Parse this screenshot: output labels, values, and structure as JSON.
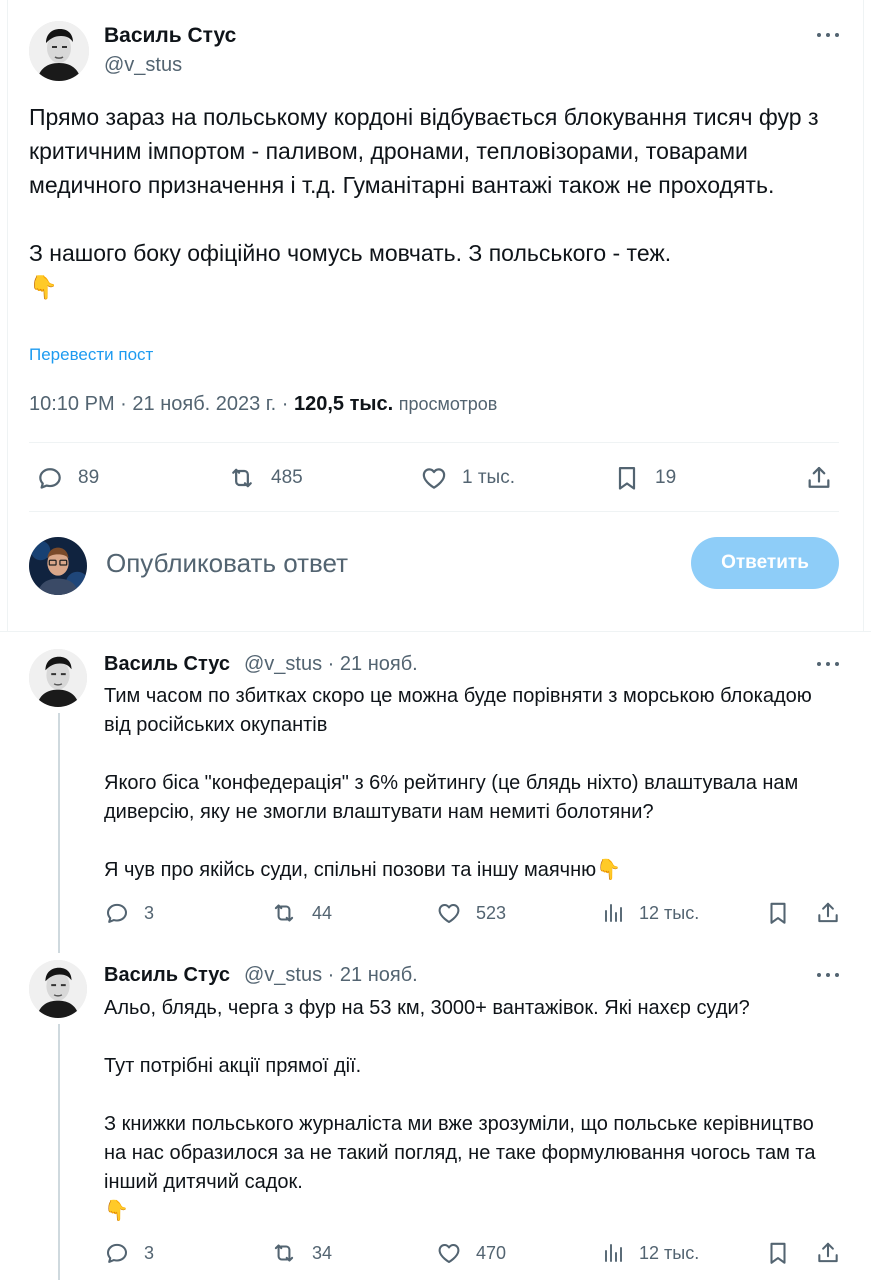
{
  "main_tweet": {
    "author_name": "Василь Стус",
    "author_handle": "@v_stus",
    "paragraph1": "Прямо зараз на польському кордоні відбувається блокування тисяч фур з критичним імпортом - паливом, дронами, тепловізорами, товарами медичного призначення і т.д. Гуманітарні вантажі також не проходять.",
    "paragraph2": "З нашого боку офіційно чомусь мовчать. З польського - теж.",
    "emoji": "👇",
    "translate_label": "Перевести пост",
    "time": "10:10 PM",
    "date": "21 нояб. 2023 г.",
    "views_count": "120,5 тыс.",
    "views_label": "просмотров",
    "replies": "89",
    "reposts": "485",
    "likes": "1 тыс.",
    "bookmarks": "19"
  },
  "composer": {
    "placeholder": "Опубликовать ответ",
    "reply_button": "Ответить"
  },
  "replies": [
    {
      "author_name": "Василь Стус",
      "author_handle": "@v_stus",
      "date": "21 нояб.",
      "paragraph1": "Тим часом по збитках скоро це можна буде порівняти з морською блокадою від російських окупантів",
      "paragraph2": "Якого біса \"конфедерація\" з 6% рейтингу (це блядь ніхто) влаштувала нам диверсію, яку не змогли влаштувати нам немиті болотяни?",
      "paragraph3": "Я чув про якійсь суди, спільні позови та іншу маячню",
      "emoji": "👇",
      "replies": "3",
      "reposts": "44",
      "likes": "523",
      "views": "12 тыс."
    },
    {
      "author_name": "Василь Стус",
      "author_handle": "@v_stus",
      "date": "21 нояб.",
      "paragraph1": "Альо, блядь, черга з фур на 53 км, 3000+ вантажівок. Які нахєр суди?",
      "paragraph2": "Тут потрібні акції прямої дії.",
      "paragraph3": "З книжки польського журналіста ми вже зрозуміли, що польське керівництво на нас образилося за не такий погляд, не таке формулювання чогось там та інший дитячий садок.",
      "emoji": "👇",
      "replies": "3",
      "reposts": "34",
      "likes": "470",
      "views": "12 тыс."
    }
  ],
  "colors": {
    "text": "#0f1419",
    "secondary": "#536471",
    "link": "#1d9bf0",
    "reply_button_disabled": "#8ecdf8",
    "divider": "#eff3f4"
  }
}
